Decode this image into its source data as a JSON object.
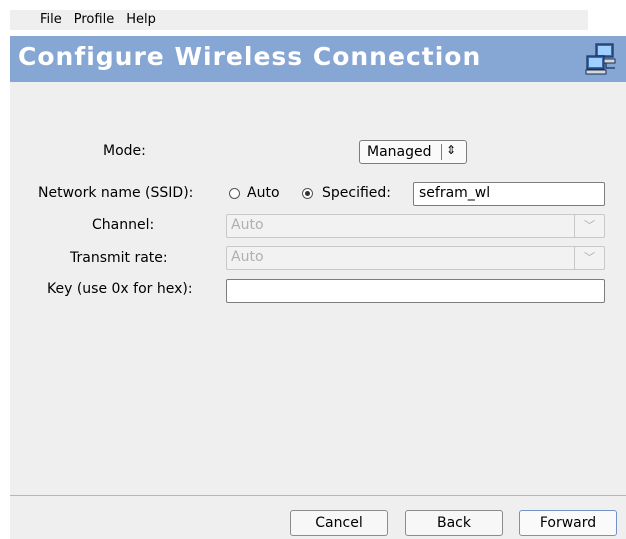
{
  "menu": [
    "File",
    "Profile",
    "Help"
  ],
  "banner": {
    "title": "Configure Wireless Connection",
    "icon": "network-computers-icon"
  },
  "form": {
    "mode_label": "Mode:",
    "mode_value": "Managed",
    "ssid_label": "Network name (SSID):",
    "ssid_auto_label": "Auto",
    "ssid_specified_label": "Specified:",
    "ssid_value": "sefram_wl",
    "ssid_choice": "Specified",
    "channel_label": "Channel:",
    "channel_value": "Auto",
    "rate_label": "Transmit rate:",
    "rate_value": "Auto",
    "key_label": "Key (use 0x for hex):",
    "key_value": ""
  },
  "buttons": {
    "cancel": "Cancel",
    "back": "Back",
    "forward": "Forward"
  },
  "colors": {
    "banner": "#86a6d4",
    "background": "#efefef"
  }
}
